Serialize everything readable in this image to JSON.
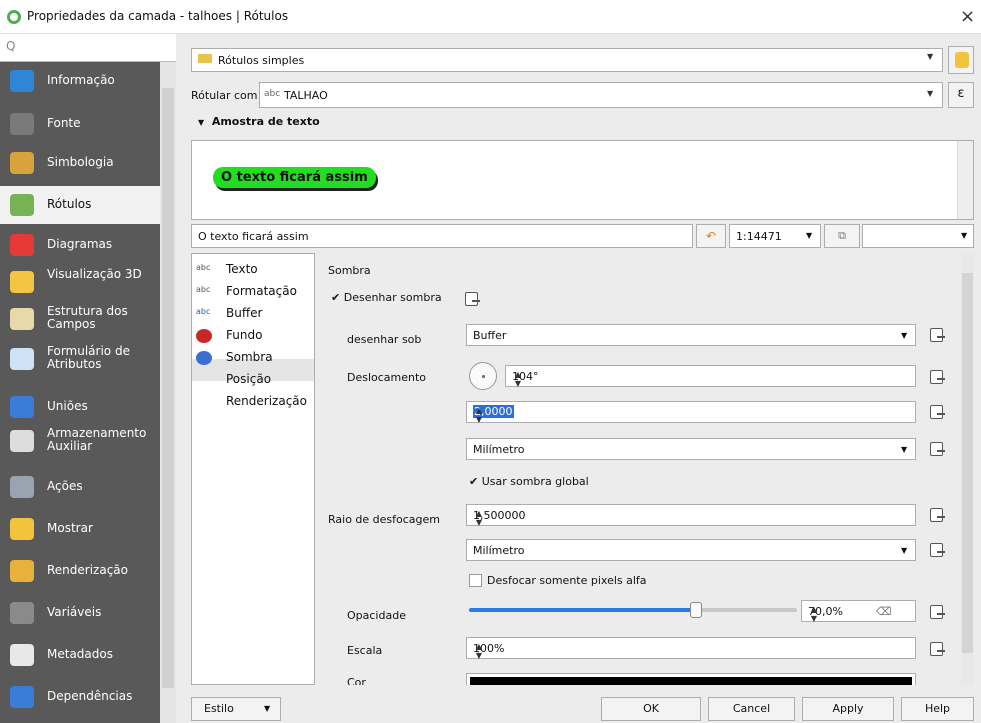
{
  "window": {
    "title": "Propriedades da camada - talhoes | Rótulos",
    "close": "×"
  },
  "sidebar": {
    "search_placeholder": "Q",
    "items": [
      {
        "label": "Informação",
        "icon": "info-icon",
        "color": "#2f86d6"
      },
      {
        "label": "Fonte",
        "icon": "source-icon",
        "color": "#7a7a7a"
      },
      {
        "label": "Simbologia",
        "icon": "symbology-icon",
        "color": "#d9a23c"
      },
      {
        "label": "Rótulos",
        "icon": "labels-icon",
        "color": "#77b255"
      },
      {
        "label": "Diagramas",
        "icon": "diagrams-icon",
        "color": "#e53935"
      },
      {
        "label": "Visualização 3D",
        "icon": "3d-view-icon",
        "color": "#f4c542"
      },
      {
        "label": "Estrutura dos Campos",
        "icon": "fields-icon",
        "color": "#e8d9a8"
      },
      {
        "label": "Formulário de Atributos",
        "icon": "form-icon",
        "color": "#cfe1f5"
      },
      {
        "label": "Uniões",
        "icon": "joins-icon",
        "color": "#3a7dd8"
      },
      {
        "label": "Armazenamento Auxiliar",
        "icon": "storage-icon",
        "color": "#dddddd"
      },
      {
        "label": "Ações",
        "icon": "actions-icon",
        "color": "#9aa4b0"
      },
      {
        "label": "Mostrar",
        "icon": "display-icon",
        "color": "#f2c43d"
      },
      {
        "label": "Renderização",
        "icon": "rendering-icon",
        "color": "#e9b13b"
      },
      {
        "label": "Variáveis",
        "icon": "variables-icon",
        "color": "#8a8a8a"
      },
      {
        "label": "Metadados",
        "icon": "metadata-icon",
        "color": "#e8e8e8"
      },
      {
        "label": "Dependências",
        "icon": "dependencies-icon",
        "color": "#3a7dd8"
      }
    ]
  },
  "top": {
    "mode": "Rótulos simples",
    "label_with_caption": "Rótular com",
    "label_with_prefix": "abc",
    "label_with_value": "TALHAO",
    "expression_button": "ε"
  },
  "sample": {
    "header": "Amostra de texto",
    "preview_text": "O texto ficará assim",
    "input_value": "O texto ficará assim",
    "scale": "1:14471"
  },
  "tree": {
    "items": [
      {
        "label": "Texto",
        "icon": "text-icon"
      },
      {
        "label": "Formatação",
        "icon": "formatting-icon"
      },
      {
        "label": "Buffer",
        "icon": "buffer-icon"
      },
      {
        "label": "Fundo",
        "icon": "background-icon"
      },
      {
        "label": "Sombra",
        "icon": "shadow-icon"
      },
      {
        "label": "Posição",
        "icon": "placement-icon"
      },
      {
        "label": "Renderização",
        "icon": "rendering-icon"
      }
    ]
  },
  "shadow": {
    "section": "Sombra",
    "draw_label": "Desenhar sombra",
    "draw_checked": true,
    "draw_under_label": "desenhar sob",
    "draw_under_value": "Buffer",
    "offset_label": "Deslocamento",
    "offset_angle": "104°",
    "offset_distance": "2,0000",
    "offset_unit": "Milímetro",
    "global_shadow_label": "Usar sombra global",
    "global_shadow_checked": true,
    "blur_label": "Raio de desfocagem",
    "blur_value": "1,500000",
    "blur_unit": "Milímetro",
    "blur_alpha_label": "Desfocar somente pixels alfa",
    "blur_alpha_checked": false,
    "opacity_label": "Opacidade",
    "opacity_value": "70,0%",
    "opacity_fraction": 0.7,
    "scale_label": "Escala",
    "scale_value": "100%",
    "color_label": "Cor",
    "color_value": "#000000"
  },
  "footer": {
    "style": "Estilo",
    "ok": "OK",
    "cancel": "Cancel",
    "apply": "Apply",
    "help": "Help"
  },
  "colors": {
    "sidebar_bg": "#595959",
    "preview_green": "#22dd22",
    "slider_blue": "#2c7be5"
  }
}
